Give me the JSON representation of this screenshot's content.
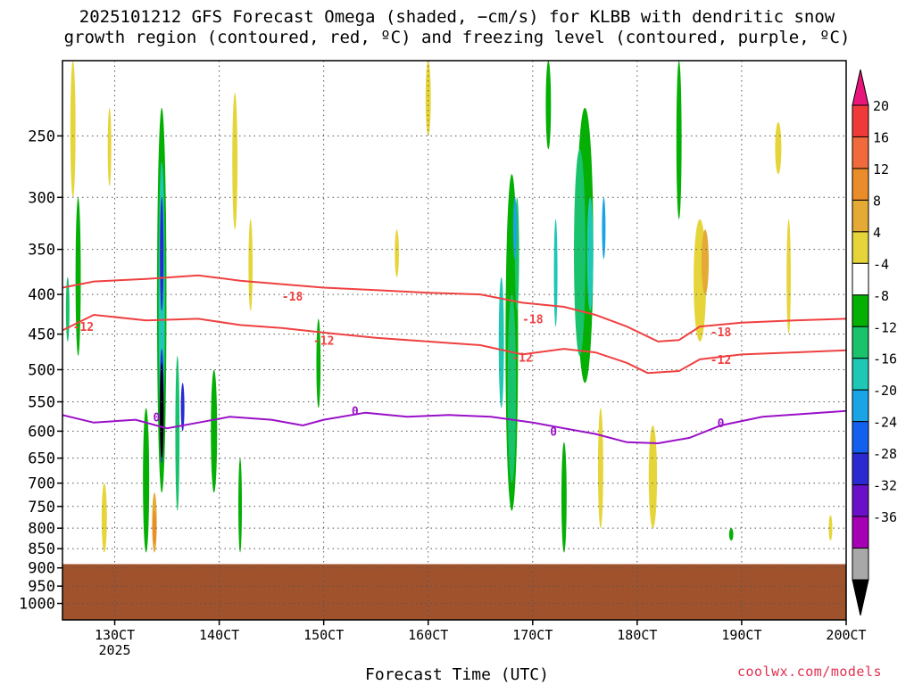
{
  "title_lines": [
    "2025101212 GFS Forecast Omega (shaded, −cm/s) for KLBB with dendritic snow",
    "growth region (contoured, red, ºC) and freezing level (contoured, purple, ºC)"
  ],
  "credit": "coolwx.com/models",
  "chart_data": {
    "type": "heatmap",
    "title": "2025101212 GFS Forecast Omega (shaded, −cm/s) for KLBB with dendritic snow growth region (contoured, red, ºC) and freezing level (contoured, purple, ºC)",
    "xlabel": "Forecast Time (UTC)",
    "ylabel": "",
    "x_ticks": [
      "130CT",
      "140CT",
      "150CT",
      "160CT",
      "170CT",
      "180CT",
      "190CT",
      "200CT"
    ],
    "x_tick_days": [
      13,
      14,
      15,
      16,
      17,
      18,
      19,
      20
    ],
    "x_year_label": "2025",
    "xlim": [
      12.5,
      20.0
    ],
    "y_ticks": [
      250,
      300,
      350,
      400,
      450,
      500,
      550,
      600,
      650,
      700,
      750,
      800,
      850,
      900,
      950,
      1000
    ],
    "ylim": [
      1050,
      200
    ],
    "y_scale": "log-pressure",
    "grid": true,
    "colorbar": {
      "labels": [
        20,
        16,
        12,
        8,
        4,
        -4,
        -8,
        -12,
        -16,
        -20,
        -24,
        -28,
        -32,
        -36
      ],
      "colors": [
        "#e8157a",
        "#f03a3a",
        "#f06a3c",
        "#ea8c2a",
        "#e4aa35",
        "#e6d53a",
        "#ffffff",
        "#05b005",
        "#18c36c",
        "#1ec8b4",
        "#1aa4e6",
        "#1460ee",
        "#2a2ad0",
        "#6a10c8",
        "#a500b4",
        "#a8a8a8",
        "#000000"
      ]
    },
    "terrain_pressure": 890,
    "terrain_color": "#a0522d",
    "contours": [
      {
        "label": "-18",
        "color": "#f04040",
        "points": [
          [
            12.5,
            392
          ],
          [
            12.8,
            385
          ],
          [
            13.3,
            382
          ],
          [
            13.8,
            378
          ],
          [
            14.2,
            384
          ],
          [
            14.6,
            388
          ],
          [
            15.0,
            392
          ],
          [
            15.5,
            395
          ],
          [
            16.0,
            398
          ],
          [
            16.5,
            400
          ],
          [
            16.9,
            410
          ],
          [
            17.3,
            415
          ],
          [
            17.6,
            425
          ],
          [
            17.9,
            440
          ],
          [
            18.2,
            460
          ],
          [
            18.4,
            458
          ],
          [
            18.6,
            440
          ],
          [
            19.0,
            435
          ],
          [
            19.5,
            432
          ],
          [
            20.0,
            430
          ]
        ]
      },
      {
        "label": "-12",
        "color": "#f04040",
        "points": [
          [
            12.5,
            445
          ],
          [
            12.8,
            425
          ],
          [
            13.3,
            432
          ],
          [
            13.8,
            430
          ],
          [
            14.2,
            438
          ],
          [
            14.6,
            442
          ],
          [
            15.0,
            448
          ],
          [
            15.5,
            455
          ],
          [
            16.0,
            460
          ],
          [
            16.5,
            465
          ],
          [
            16.9,
            478
          ],
          [
            17.3,
            470
          ],
          [
            17.6,
            475
          ],
          [
            17.9,
            490
          ],
          [
            18.1,
            505
          ],
          [
            18.4,
            502
          ],
          [
            18.6,
            485
          ],
          [
            19.0,
            478
          ],
          [
            19.5,
            475
          ],
          [
            20.0,
            472
          ]
        ]
      },
      {
        "label": "0",
        "color": "#9a10c8",
        "points": [
          [
            12.5,
            572
          ],
          [
            12.8,
            585
          ],
          [
            13.2,
            580
          ],
          [
            13.5,
            595
          ],
          [
            13.8,
            585
          ],
          [
            14.1,
            575
          ],
          [
            14.5,
            580
          ],
          [
            14.8,
            590
          ],
          [
            15.0,
            580
          ],
          [
            15.4,
            568
          ],
          [
            15.8,
            575
          ],
          [
            16.2,
            572
          ],
          [
            16.6,
            575
          ],
          [
            17.0,
            585
          ],
          [
            17.3,
            595
          ],
          [
            17.6,
            605
          ],
          [
            17.9,
            620
          ],
          [
            18.2,
            622
          ],
          [
            18.5,
            612
          ],
          [
            18.8,
            590
          ],
          [
            19.2,
            575
          ],
          [
            19.6,
            570
          ],
          [
            20.0,
            565
          ]
        ]
      }
    ],
    "contour_labels": [
      {
        "text": "-18",
        "x": 14.7,
        "p": 402,
        "color": "#f04040"
      },
      {
        "text": "-18",
        "x": 17.0,
        "p": 430,
        "color": "#f04040"
      },
      {
        "text": "-18",
        "x": 18.8,
        "p": 447,
        "color": "#f04040"
      },
      {
        "text": "-12",
        "x": 12.7,
        "p": 440,
        "color": "#f04040"
      },
      {
        "text": "-12",
        "x": 15.0,
        "p": 458,
        "color": "#f04040"
      },
      {
        "text": "-12",
        "x": 16.9,
        "p": 482,
        "color": "#f04040"
      },
      {
        "text": "-12",
        "x": 18.8,
        "p": 485,
        "color": "#f04040"
      },
      {
        "text": "0",
        "x": 13.4,
        "p": 575,
        "color": "#9a10c8"
      },
      {
        "text": "0",
        "x": 15.3,
        "p": 565,
        "color": "#9a10c8"
      },
      {
        "text": "0",
        "x": 17.2,
        "p": 600,
        "color": "#9a10c8"
      },
      {
        "text": "0",
        "x": 18.8,
        "p": 585,
        "color": "#9a10c8"
      }
    ],
    "omega_features": [
      {
        "x": 13.45,
        "p_top": 230,
        "p_bottom": 720,
        "w": 0.09,
        "value": -8
      },
      {
        "x": 13.45,
        "p_top": 270,
        "p_bottom": 620,
        "w": 0.06,
        "value": -16
      },
      {
        "x": 13.45,
        "p_top": 300,
        "p_bottom": 420,
        "w": 0.035,
        "value": -28
      },
      {
        "x": 13.45,
        "p_top": 470,
        "p_bottom": 660,
        "w": 0.04,
        "value": -28
      },
      {
        "x": 13.45,
        "p_top": 490,
        "p_bottom": 650,
        "w": 0.025,
        "value": -36
      },
      {
        "x": 13.6,
        "p_top": 480,
        "p_bottom": 760,
        "w": 0.04,
        "value": -12
      },
      {
        "x": 13.65,
        "p_top": 520,
        "p_bottom": 600,
        "w": 0.02,
        "value": -28
      },
      {
        "x": 13.3,
        "p_top": 560,
        "p_bottom": 860,
        "w": 0.06,
        "value": -8
      },
      {
        "x": 13.38,
        "p_top": 720,
        "p_bottom": 860,
        "w": 0.045,
        "value": 8
      },
      {
        "x": 13.38,
        "p_top": 760,
        "p_bottom": 840,
        "w": 0.025,
        "value": 12
      },
      {
        "x": 12.65,
        "p_top": 300,
        "p_bottom": 480,
        "w": 0.05,
        "value": -8
      },
      {
        "x": 12.55,
        "p_top": 380,
        "p_bottom": 460,
        "w": 0.03,
        "value": -12
      },
      {
        "x": 12.6,
        "p_top": 200,
        "p_bottom": 300,
        "w": 0.05,
        "value": 4
      },
      {
        "x": 12.9,
        "p_top": 700,
        "p_bottom": 860,
        "w": 0.05,
        "value": 4
      },
      {
        "x": 13.95,
        "p_top": 500,
        "p_bottom": 720,
        "w": 0.06,
        "value": -8
      },
      {
        "x": 16.8,
        "p_top": 280,
        "p_bottom": 760,
        "w": 0.12,
        "value": -8
      },
      {
        "x": 16.8,
        "p_top": 400,
        "p_bottom": 700,
        "w": 0.08,
        "value": -12
      },
      {
        "x": 16.7,
        "p_top": 380,
        "p_bottom": 560,
        "w": 0.05,
        "value": -16
      },
      {
        "x": 16.85,
        "p_top": 300,
        "p_bottom": 420,
        "w": 0.04,
        "value": -12
      },
      {
        "x": 16.83,
        "p_top": 300,
        "p_bottom": 360,
        "w": 0.02,
        "value": -20
      },
      {
        "x": 17.5,
        "p_top": 230,
        "p_bottom": 520,
        "w": 0.16,
        "value": -8
      },
      {
        "x": 17.45,
        "p_top": 260,
        "p_bottom": 480,
        "w": 0.11,
        "value": -12
      },
      {
        "x": 17.55,
        "p_top": 300,
        "p_bottom": 420,
        "w": 0.06,
        "value": -16
      },
      {
        "x": 17.22,
        "p_top": 320,
        "p_bottom": 440,
        "w": 0.03,
        "value": -16
      },
      {
        "x": 17.68,
        "p_top": 300,
        "p_bottom": 360,
        "w": 0.02,
        "value": -20
      },
      {
        "x": 17.15,
        "p_top": 200,
        "p_bottom": 260,
        "w": 0.05,
        "value": -8
      },
      {
        "x": 17.65,
        "p_top": 560,
        "p_bottom": 800,
        "w": 0.05,
        "value": 4
      },
      {
        "x": 17.3,
        "p_top": 620,
        "p_bottom": 860,
        "w": 0.05,
        "value": -8
      },
      {
        "x": 18.6,
        "p_top": 320,
        "p_bottom": 460,
        "w": 0.12,
        "value": 4
      },
      {
        "x": 18.65,
        "p_top": 330,
        "p_bottom": 400,
        "w": 0.07,
        "value": 8
      },
      {
        "x": 18.15,
        "p_top": 590,
        "p_bottom": 800,
        "w": 0.08,
        "value": 4
      },
      {
        "x": 14.15,
        "p_top": 220,
        "p_bottom": 330,
        "w": 0.05,
        "value": 4
      },
      {
        "x": 14.3,
        "p_top": 320,
        "p_bottom": 420,
        "w": 0.04,
        "value": 4
      },
      {
        "x": 14.95,
        "p_top": 430,
        "p_bottom": 560,
        "w": 0.04,
        "value": -8
      },
      {
        "x": 14.2,
        "p_top": 650,
        "p_bottom": 860,
        "w": 0.03,
        "value": -8
      },
      {
        "x": 15.7,
        "p_top": 330,
        "p_bottom": 380,
        "w": 0.04,
        "value": 4
      },
      {
        "x": 16.0,
        "p_top": 200,
        "p_bottom": 250,
        "w": 0.05,
        "value": 4
      },
      {
        "x": 19.35,
        "p_top": 240,
        "p_bottom": 280,
        "w": 0.06,
        "value": 4
      },
      {
        "x": 19.45,
        "p_top": 320,
        "p_bottom": 450,
        "w": 0.04,
        "value": 4
      },
      {
        "x": 19.85,
        "p_top": 770,
        "p_bottom": 830,
        "w": 0.03,
        "value": 4
      },
      {
        "x": 18.9,
        "p_top": 800,
        "p_bottom": 830,
        "w": 0.04,
        "value": -8
      },
      {
        "x": 18.4,
        "p_top": 200,
        "p_bottom": 320,
        "w": 0.05,
        "value": -8
      },
      {
        "x": 12.95,
        "p_top": 230,
        "p_bottom": 290,
        "w": 0.03,
        "value": 4
      }
    ]
  }
}
